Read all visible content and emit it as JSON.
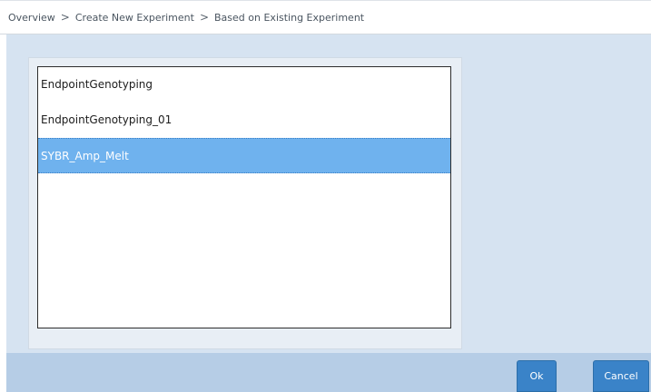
{
  "breadcrumb": {
    "items": [
      "Overview",
      "Create New Experiment",
      "Based on Existing Experiment"
    ],
    "separator": ">"
  },
  "experiment_list": {
    "items": [
      {
        "label": "EndpointGenotyping",
        "selected": false
      },
      {
        "label": "EndpointGenotyping_01",
        "selected": false
      },
      {
        "label": "SYBR_Amp_Melt",
        "selected": true
      }
    ]
  },
  "footer": {
    "ok_label": "Ok",
    "cancel_label": "Cancel"
  },
  "colors": {
    "content_background": "#d6e3f1",
    "footer_background": "#b6cde6",
    "selection": "#6fb2ee",
    "button": "#3a83c8"
  }
}
